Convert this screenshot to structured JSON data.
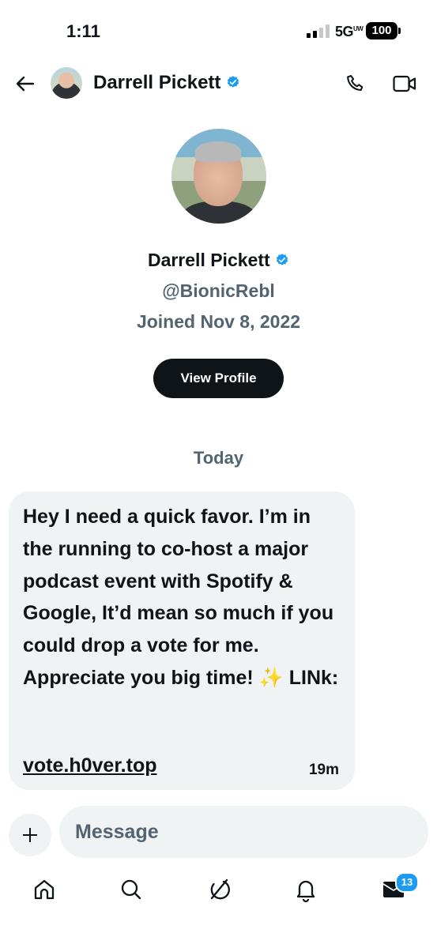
{
  "status": {
    "time": "1:11",
    "network": "5G",
    "network_sup": "UW",
    "battery": "100"
  },
  "header": {
    "name": "Darrell Pickett"
  },
  "profile": {
    "name": "Darrell Pickett",
    "handle": "@BionicRebl",
    "joined": "Joined Nov 8, 2022",
    "view_profile_label": "View Profile"
  },
  "conversation": {
    "date_separator": "Today",
    "messages": [
      {
        "text": "Hey I need a quick favor. I’m in the running to co-host a major podcast event with Spotify & Google, It’d mean so much if you could drop a vote for me. Appreciate you big time! ✨ LINk:",
        "link": "vote.h0ver.top",
        "time": "19m"
      }
    ]
  },
  "composer": {
    "placeholder": "Message"
  },
  "nav": {
    "items": [
      "home-icon",
      "search-icon",
      "grok-icon",
      "bell-icon",
      "mail-icon"
    ],
    "messages_badge": "13"
  },
  "colors": {
    "accent": "#1d9bf0",
    "text": "#0f1419",
    "secondary": "#536471",
    "bubble": "#eff3f4"
  }
}
